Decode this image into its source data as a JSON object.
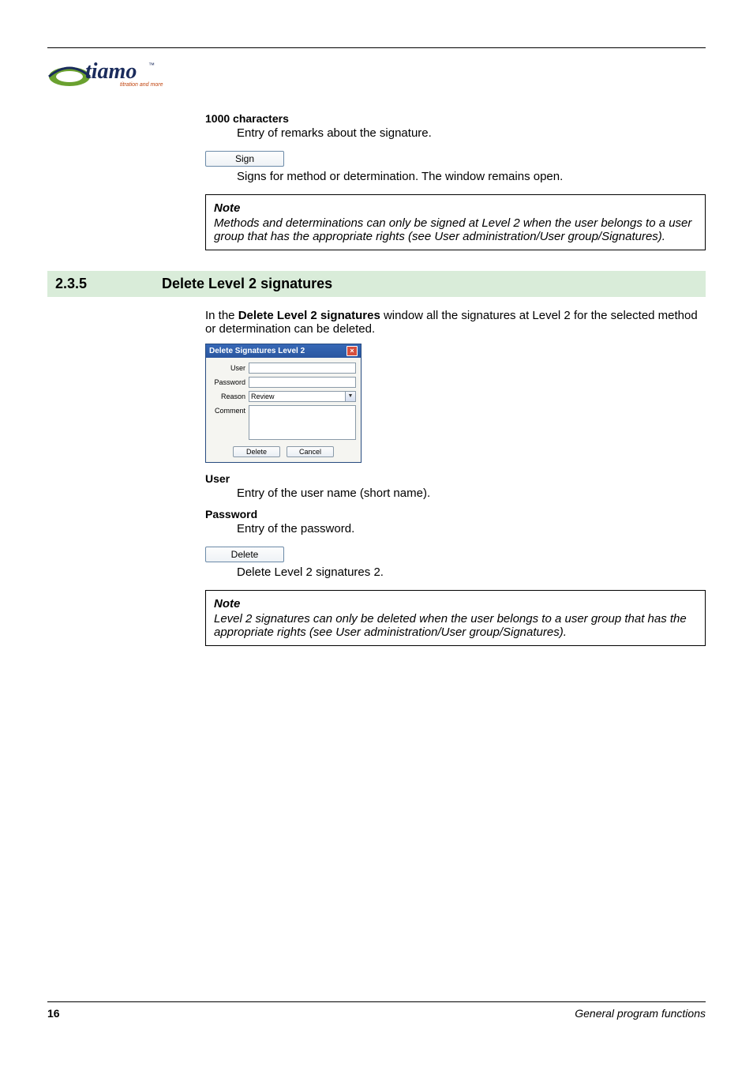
{
  "logo": {
    "name": "tiamo",
    "tagline": "titration and more"
  },
  "top": {
    "char_heading": "1000 characters",
    "char_desc": "Entry of remarks about the signature.",
    "sign_btn": "Sign",
    "sign_desc": "Signs for method or determination. The window remains open.",
    "note_title": "Note",
    "note_body": "Methods and determinations can only be signed at Level 2 when the user belongs to a user group that has the appropriate rights (see User administration/User group/Signatures)."
  },
  "section": {
    "num": "2.3.5",
    "title": "Delete Level 2 signatures",
    "intro_pre": "In the ",
    "intro_bold": "Delete Level 2 signatures",
    "intro_post": " window all the signatures at Level 2 for the selected method or determination can be deleted."
  },
  "dialog": {
    "title": "Delete Signatures Level 2",
    "labels": {
      "user": "User",
      "password": "Password",
      "reason": "Reason",
      "comment": "Comment"
    },
    "values": {
      "user": "",
      "password": "",
      "reason": "Review",
      "comment": ""
    },
    "buttons": {
      "delete": "Delete",
      "cancel": "Cancel"
    }
  },
  "fields": {
    "user_h": "User",
    "user_d": "Entry of the user name (short name).",
    "pwd_h": "Password",
    "pwd_d": "Entry of the password.",
    "del_btn": "Delete",
    "del_d": "Delete Level 2 signatures 2.",
    "note_title": "Note",
    "note_body": "Level 2 signatures can only be deleted when the user belongs to a user group that has the appropriate rights (see User administration/User group/Signatures)."
  },
  "footer": {
    "page": "16",
    "section": "General program functions"
  }
}
